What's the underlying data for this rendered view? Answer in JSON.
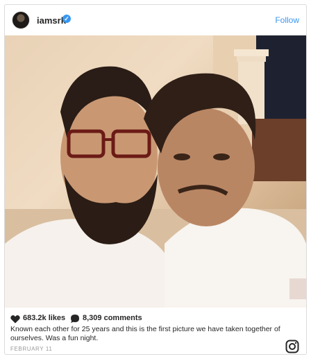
{
  "post": {
    "username": "iamsrk",
    "verified_mark": "✓",
    "follow_label": "Follow",
    "likes": "683.2k likes",
    "comments": "8,309 comments",
    "caption": "Known each other for 25 years and this is the first picture we have taken together of ourselves. Was a fun night.",
    "date": "FEBRUARY 11"
  },
  "icons": {
    "heart": "heart-icon",
    "comment": "comment-icon",
    "instagram": "instagram-icon"
  },
  "colors": {
    "accent": "#3897f0",
    "text": "#262626",
    "muted": "#999999"
  }
}
